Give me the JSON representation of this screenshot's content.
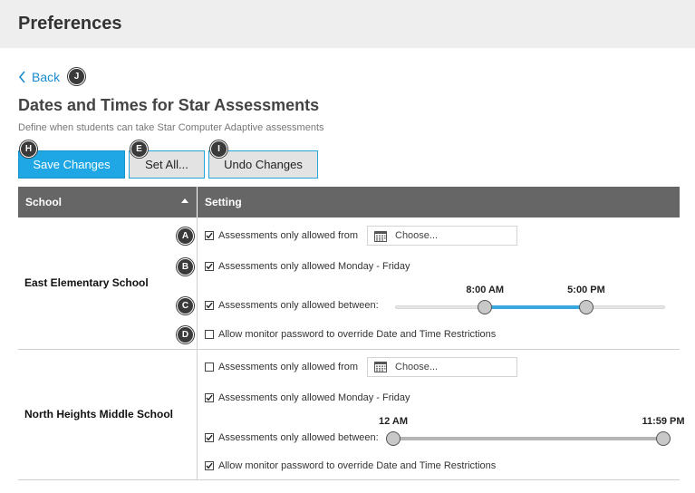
{
  "header": {
    "title": "Preferences"
  },
  "nav": {
    "back_label": "Back"
  },
  "page": {
    "title": "Dates and Times for Star Assessments",
    "subtitle": "Define when students can take Star Computer Adaptive assessments"
  },
  "toolbar": {
    "save_label": "Save Changes",
    "set_all_label": "Set All...",
    "undo_label": "Undo Changes"
  },
  "callouts": {
    "a": "A",
    "b": "B",
    "c": "C",
    "d": "D",
    "e": "E",
    "h": "H",
    "i": "I",
    "j": "J"
  },
  "table": {
    "col_school": "School",
    "col_setting": "Setting",
    "rows": [
      {
        "school": "East Elementary School",
        "date_label": "Assessments only allowed from",
        "date_placeholder": "Choose...",
        "weekday_label": "Assessments only allowed Monday - Friday",
        "between_label": "Assessments only allowed between:",
        "start_time": "8:00 AM",
        "end_time": "5:00 PM",
        "start_fraction": 0.333,
        "end_fraction": 0.708,
        "override_label": "Allow monitor password to override Date and Time Restrictions",
        "date_checked": true,
        "weekday_checked": true,
        "between_checked": true,
        "override_checked": false
      },
      {
        "school": "North Heights Middle School",
        "date_label": "Assessments only allowed from",
        "date_placeholder": "Choose...",
        "weekday_label": "Assessments only allowed Monday - Friday",
        "between_label": "Assessments only allowed between:",
        "start_time": "12 AM",
        "end_time": "11:59 PM",
        "start_fraction": 0.0,
        "end_fraction": 1.0,
        "override_label": "Allow monitor password to override Date and Time Restrictions",
        "date_checked": false,
        "weekday_checked": true,
        "between_checked": true,
        "override_checked": true
      }
    ]
  },
  "colors": {
    "accent": "#1ea7e4",
    "slider_active": "#3aa8e0",
    "slider_inactive": "#b5b5b5",
    "header_bg": "#666666"
  }
}
